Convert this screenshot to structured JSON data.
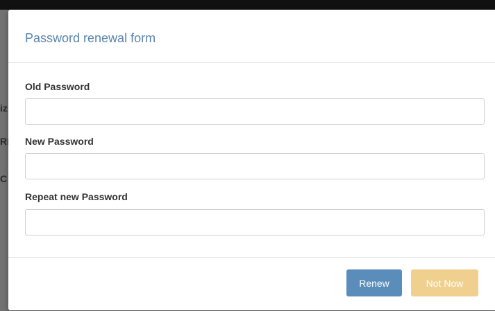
{
  "modal": {
    "title": "Password renewal form",
    "fields": [
      {
        "label": "Old Password",
        "value": ""
      },
      {
        "label": "New Password",
        "value": ""
      },
      {
        "label": "Repeat new Password",
        "value": ""
      }
    ],
    "buttons": {
      "renew": "Renew",
      "not_now": "Not Now"
    }
  },
  "background_fragments": [
    "iz",
    "RI",
    "C"
  ],
  "colors": {
    "title": "#5b85ad",
    "primary_button": "#5b8dba",
    "warning_button": "#f0d08e",
    "backdrop": "#727272",
    "topbar": "#111111"
  }
}
